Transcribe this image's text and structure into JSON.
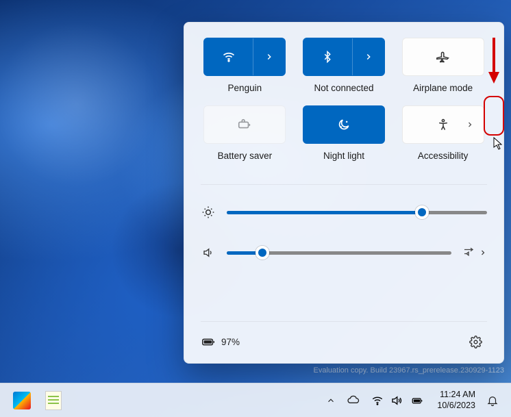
{
  "tiles": [
    {
      "id": "wifi",
      "label": "Penguin",
      "active": true,
      "split": true,
      "icon": "wifi"
    },
    {
      "id": "bluetooth",
      "label": "Not connected",
      "active": true,
      "split": true,
      "icon": "bluetooth"
    },
    {
      "id": "airplane",
      "label": "Airplane mode",
      "active": false,
      "split": false,
      "icon": "airplane"
    },
    {
      "id": "battery-saver",
      "label": "Battery saver",
      "active": false,
      "disabled": true,
      "split": false,
      "icon": "battery-saver"
    },
    {
      "id": "night-light",
      "label": "Night light",
      "active": true,
      "split": false,
      "icon": "night-light"
    },
    {
      "id": "accessibility",
      "label": "Accessibility",
      "active": false,
      "split": false,
      "chevron": true,
      "icon": "accessibility"
    }
  ],
  "brightness": {
    "value": 75
  },
  "volume": {
    "value": 16
  },
  "battery": {
    "percent_label": "97%"
  },
  "taskbar": {
    "time": "11:24 AM",
    "date": "10/6/2023"
  },
  "watermark": "Evaluation copy. Build 23967.rs_prerelease.230929-1123",
  "colors": {
    "accent": "#0067c0"
  }
}
